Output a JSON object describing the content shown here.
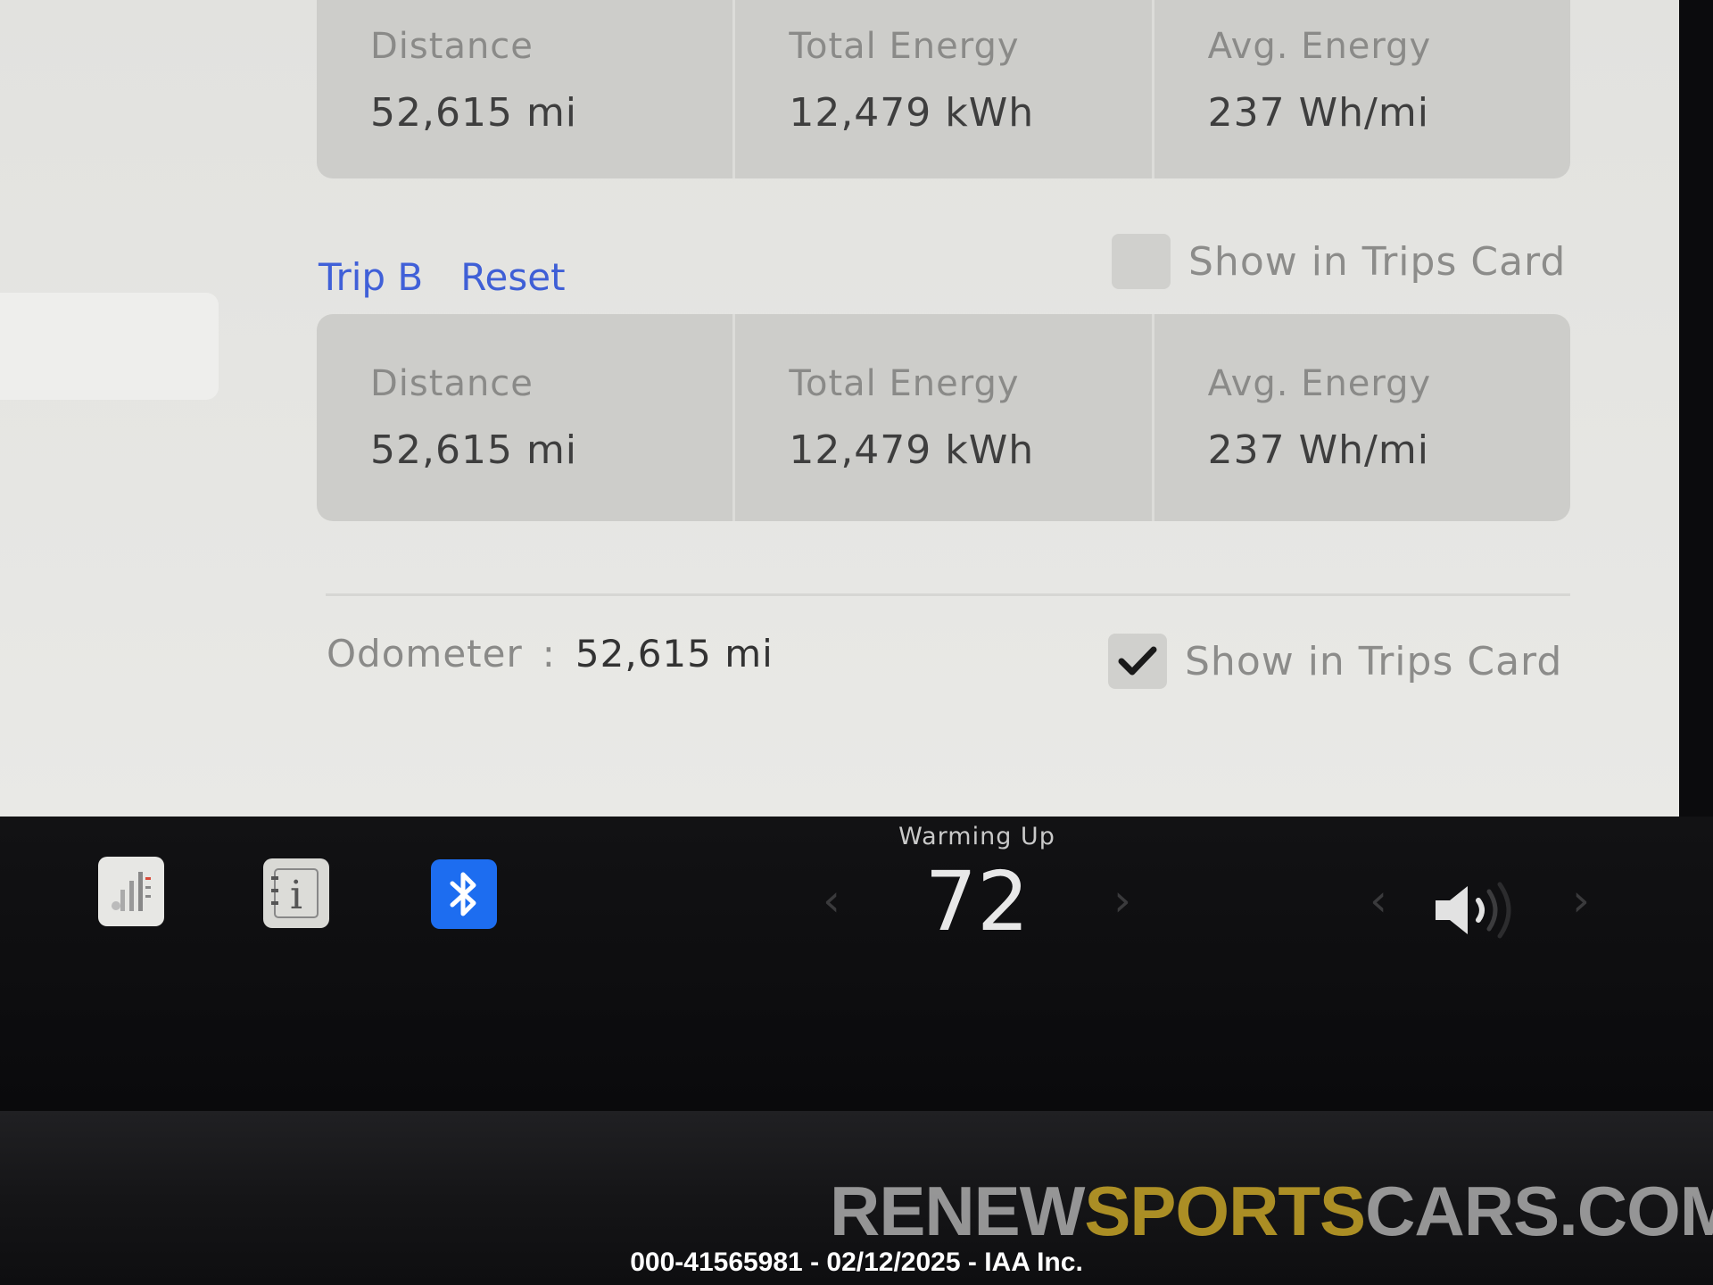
{
  "trip_a": {
    "distance_label": "Distance",
    "distance_value": "52,615 mi",
    "total_energy_label": "Total Energy",
    "total_energy_value": "12,479 kWh",
    "avg_energy_label": "Avg. Energy",
    "avg_energy_value": "237 Wh/mi"
  },
  "trip_b": {
    "title": "Trip B",
    "reset_label": "Reset",
    "show_in_trips_label": "Show in Trips Card",
    "show_in_trips_checked": false,
    "distance_label": "Distance",
    "distance_value": "52,615 mi",
    "total_energy_label": "Total Energy",
    "total_energy_value": "12,479 kWh",
    "avg_energy_label": "Avg. Energy",
    "avg_energy_value": "237 Wh/mi"
  },
  "odometer": {
    "label": "Odometer",
    "separator": ":",
    "value": "52,615 mi",
    "show_in_trips_label": "Show in Trips Card",
    "show_in_trips_checked": true
  },
  "taskbar": {
    "icons": [
      "energy-app-icon",
      "manual-app-icon",
      "bluetooth-icon"
    ],
    "climate_status": "Warming Up",
    "temperature": "72",
    "volume_icon": "speaker-volume-icon"
  },
  "watermark": {
    "part1": "RENEW",
    "part2": "SPORTS",
    "part3": "CARS.COM"
  },
  "caption": "000-41565981 - 02/12/2025 - IAA Inc.",
  "colors": {
    "accent_blue": "#4060d8",
    "bluetooth_bg": "#1d6df0",
    "card_bg": "#cdcdca",
    "screen_bg": "#e4e4e1",
    "watermark_gold": "#cdaa28"
  }
}
